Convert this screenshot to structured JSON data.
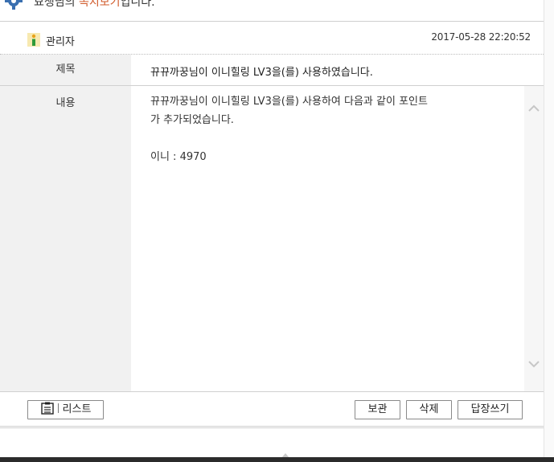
{
  "header": {
    "prefix": "묘쟁님의 ",
    "accent": "쪽지보기",
    "suffix": "입니다."
  },
  "message": {
    "sender": "관리자",
    "date": "2017-05-28 22:20:52",
    "subject_label": "제목",
    "subject": "뀨뀨까꿍님이 이니힐링 LV3을(를) 사용하였습니다.",
    "content_label": "내용",
    "content_lines": [
      "뀨뀨까꿍님이 이니힐링 LV3을(를) 사용하여 다음과 같이 포인트",
      "가 추가되었습니다.",
      "",
      "이니 : 4970"
    ]
  },
  "buttons": {
    "list": "리스트",
    "save": "보관",
    "delete": "삭제",
    "reply": "답장쓰기"
  },
  "colors": {
    "accent": "#d05a2a",
    "label_bg": "#f1f1f1"
  }
}
